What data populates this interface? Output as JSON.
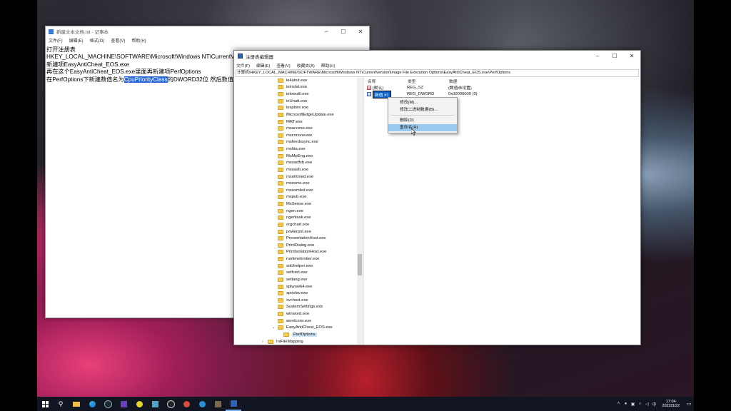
{
  "notepad": {
    "title": "新建文本文档.txt - 记事本",
    "menu": [
      "文件(F)",
      "编辑(E)",
      "格式(O)",
      "查看(V)",
      "帮助(H)"
    ],
    "lines": [
      "打开注册表",
      "HKEY_LOCAL_MACHINE\\SOFTWARE\\Microsoft\\Windows NT\\CurrentVe",
      "新建项EasyAntiCheat_EOS.exe",
      "再在这个EasyAntiCheat_EOS.exe里面再新建项PerfOptions"
    ],
    "line5_before": "在PerfOptions下新建数值名为",
    "line5_highlight": "CpuPriorityClass",
    "line5_after": "的DWORD32位 然后数值数",
    "status": "第 5"
  },
  "regedit": {
    "title": "注册表编辑器",
    "menu": [
      "文件(F)",
      "编辑(E)",
      "查看(V)",
      "收藏夹(A)",
      "帮助(H)"
    ],
    "address": "计算机\\HKEY_LOCAL_MACHINE\\SOFTWARE\\Microsoft\\Windows NT\\CurrentVersion\\Image File Execution Options\\EasyAntiCheat_EOS.exe\\PerfOptions",
    "tree": [
      "ie4uinit.exe",
      "ieinstal.exe",
      "ielowutil.exe",
      "ieUnatt.exe",
      "iexplore.exe",
      "MicrosoftEdgeUpdate.exe",
      "MRT.exe",
      "msaccess.exe",
      "mscorsvw.exe",
      "msfeedssync.exe",
      "mshta.exe",
      "MsMpEng.exe",
      "msoadfsb.exe",
      "msoasb.exe",
      "msohtmed.exe",
      "msoxmc.exe",
      "msoxmled.exe",
      "mspub.exe",
      "MsSense.exe",
      "ngen.exe",
      "ngentask.exe",
      "orgchart.exe",
      "powerpnt.exe",
      "PresentationHost.exe",
      "PrintDialog.exe",
      "PrintIsolationHost.exe",
      "runtimebroker.exe",
      "sdclhelper.exe",
      "selfcert.exe",
      "setlang.exe",
      "splwow64.exe",
      "spoolsv.exe",
      "svchost.exe",
      "SystemSettings.exe",
      "winword.exe",
      "wordconv.exe"
    ],
    "tree_eac": "EasyAntiCheat_EOS.exe",
    "tree_perf": "PerfOptions",
    "tree_next": "IniFileMapping",
    "values_header": {
      "name": "名称",
      "type": "类型",
      "data": "数据"
    },
    "values": [
      {
        "name": "(默认)",
        "type": "REG_SZ",
        "data": "(数值未设置)"
      },
      {
        "name": "新值 #1",
        "type": "REG_DWORD",
        "data": "0x00000000 (0)"
      }
    ],
    "context_menu": [
      "修改(M)...",
      "修改二进制数据(B)...",
      "删除(D)",
      "重命名(R)"
    ]
  },
  "taskbar": {
    "icons": [
      "start-icon",
      "search-icon",
      "edge-icon",
      "steam-icon",
      "app-icon",
      "game-icon",
      "app-icon",
      "explorer-icon",
      "app-icon",
      "browser-icon",
      "app-icon",
      "app-icon",
      "regedit-icon"
    ],
    "time": "17:04",
    "date": "2022/3/22",
    "ime": "中"
  },
  "colors": {
    "selection": "#2a6ad6",
    "menu_hover": "#99c9ef",
    "taskbar": "#101521"
  }
}
